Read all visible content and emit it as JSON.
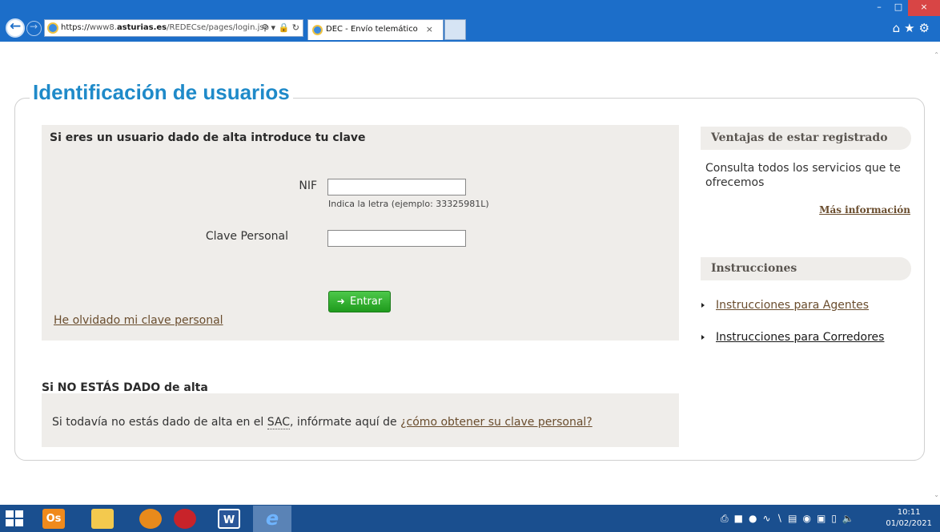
{
  "browser": {
    "address": {
      "scheme": "https://",
      "pre_host": "www8.",
      "host": "asturias.es",
      "path": "/REDECse/pages/login.jsp"
    },
    "tab_title": "DEC - Envío telemático",
    "tab_close": "×",
    "window_buttons": {
      "minimize": "–",
      "restore": "□",
      "close": "×"
    },
    "toolbar_icons": [
      "home-icon",
      "favorites-star-icon",
      "settings-gear-icon"
    ]
  },
  "page": {
    "title": "Identificación de usuarios",
    "login": {
      "heading": "Si eres un usuario dado de alta introduce tu clave",
      "nif_label": "NIF",
      "nif_value": "",
      "nif_hint": "Indica la letra (ejemplo: 33325981L)",
      "password_label": "Clave Personal",
      "password_value": "",
      "enter_button": "Entrar",
      "forgot_link": "He olvidado mi clave personal"
    },
    "no_alta": {
      "heading": "Si NO ESTÁS DADO de alta",
      "text_before": "Si todavía no estás dado de alta en el ",
      "sac": "SAC",
      "text_after": ", infórmate aquí de ",
      "link": "¿cómo obtener su clave personal?"
    },
    "sidebar": {
      "ventajas_heading": "Ventajas de estar registrado",
      "ventajas_text": "Consulta todos los servicios que te ofrecemos",
      "mas_info": "Más información",
      "instrucciones_heading": "Instrucciones",
      "instrucciones": [
        {
          "label": "Instrucciones para Agentes"
        },
        {
          "label": "Instrucciones para Corredores"
        }
      ]
    }
  },
  "taskbar": {
    "apps": [
      "outlook",
      "file-explorer",
      "firefox",
      "acrobat-reader",
      "word",
      "internet-explorer"
    ],
    "app_glyphs": {
      "outlook": "Os",
      "word": "W",
      "ie": "e"
    },
    "clock_time": "10:11",
    "clock_date": "01/02/2021"
  }
}
